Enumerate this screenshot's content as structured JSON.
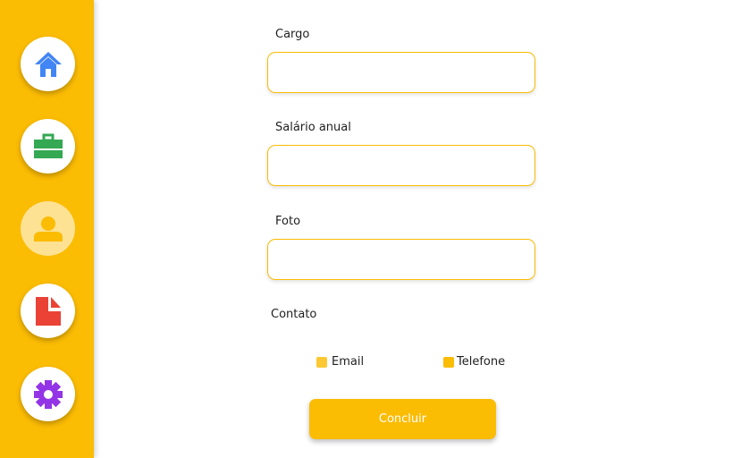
{
  "sidebar": {
    "items": [
      {
        "icon": "home-icon",
        "color": "#4285f4"
      },
      {
        "icon": "briefcase-icon",
        "color": "#34a853"
      },
      {
        "icon": "user-icon",
        "color": "#fbbc04",
        "active": true
      },
      {
        "icon": "document-icon",
        "color": "#ea4335"
      },
      {
        "icon": "gear-icon",
        "color": "#9334e6"
      }
    ],
    "background": "#fbbc04"
  },
  "form": {
    "cargo_label": "Cargo",
    "cargo_value": "",
    "salario_label": "Salário anual",
    "salario_value": "",
    "foto_label": "Foto",
    "foto_value": "",
    "contato_label": "Contato",
    "contato_options": {
      "email": "Email",
      "telefone": "Telefone"
    },
    "submit_label": "Concluir"
  },
  "colors": {
    "accent": "#fbbc04",
    "field_border": "#fbbc04"
  }
}
